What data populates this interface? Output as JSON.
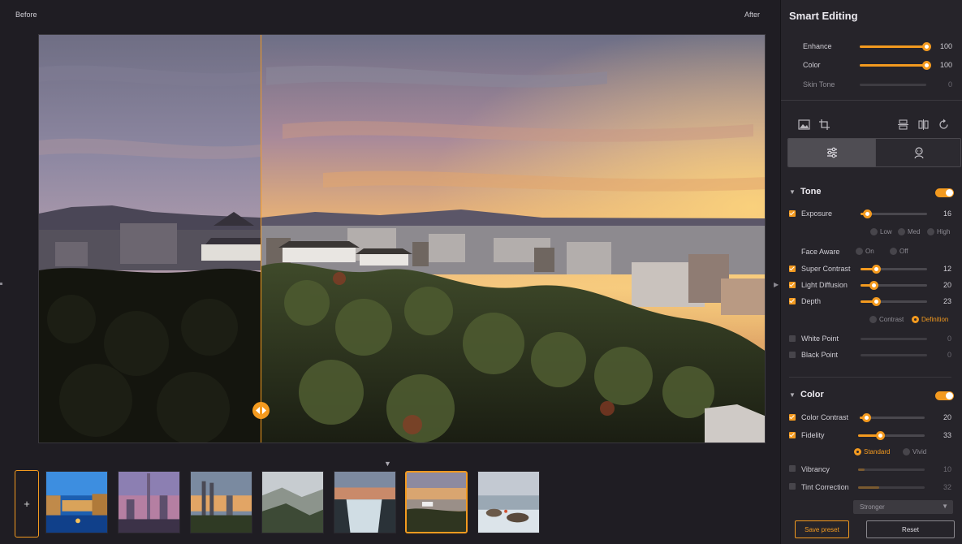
{
  "compare": {
    "before_label": "Before",
    "after_label": "After"
  },
  "filmstrip": {
    "add_label": "+",
    "thumbnails": [
      "venice-canal",
      "dubai-skyline",
      "kuala-lumpur-skyline",
      "misty-mountains",
      "waterfall",
      "castle-sunset",
      "rocky-beach"
    ],
    "selected_index": 5
  },
  "panel": {
    "title": "Smart Editing",
    "smart": [
      {
        "label": "Enhance",
        "value": "100",
        "fraction": 1.0,
        "active": true
      },
      {
        "label": "Color",
        "value": "100",
        "fraction": 1.0,
        "active": true
      },
      {
        "label": "Skin Tone",
        "value": "0",
        "fraction": 0.0,
        "active": false
      }
    ],
    "tone": {
      "title": "Tone",
      "enabled": true,
      "exposure": {
        "label": "Exposure",
        "value": "16",
        "fraction": 0.1,
        "checked": true
      },
      "exposure_levels": [
        "Low",
        "Med",
        "High"
      ],
      "face_aware": {
        "label": "Face Aware",
        "options": [
          "On",
          "Off"
        ]
      },
      "super_contrast": {
        "label": "Super Contrast",
        "value": "12",
        "fraction": 0.23,
        "checked": true
      },
      "light_diffusion": {
        "label": "Light Diffusion",
        "value": "20",
        "fraction": 0.2,
        "checked": true
      },
      "depth": {
        "label": "Depth",
        "value": "23",
        "fraction": 0.23,
        "checked": true
      },
      "depth_modes": [
        "Contrast",
        "Definition"
      ],
      "depth_mode_selected": "Definition",
      "white_point": {
        "label": "White Point",
        "value": "0",
        "fraction": 0,
        "checked": false
      },
      "black_point": {
        "label": "Black Point",
        "value": "0",
        "fraction": 0,
        "checked": false
      }
    },
    "color": {
      "title": "Color",
      "enabled": true,
      "color_contrast": {
        "label": "Color Contrast",
        "value": "20",
        "fraction": 0.1,
        "checked": true
      },
      "fidelity": {
        "label": "Fidelity",
        "value": "33",
        "fraction": 0.33,
        "checked": true
      },
      "fidelity_modes": [
        "Standard",
        "Vivid"
      ],
      "fidelity_mode_selected": "Standard",
      "vibrancy": {
        "label": "Vibrancy",
        "value": "10",
        "fraction": 0.1,
        "checked": false
      },
      "tint_correction": {
        "label": "Tint Correction",
        "value": "32",
        "fraction": 0.32,
        "checked": false
      },
      "strength_select": "Stronger"
    },
    "buttons": {
      "save_preset": "Save preset",
      "reset": "Reset"
    }
  },
  "colors": {
    "accent": "#f39a1f",
    "panel_bg": "#26242a",
    "app_bg": "#1f1d23"
  }
}
